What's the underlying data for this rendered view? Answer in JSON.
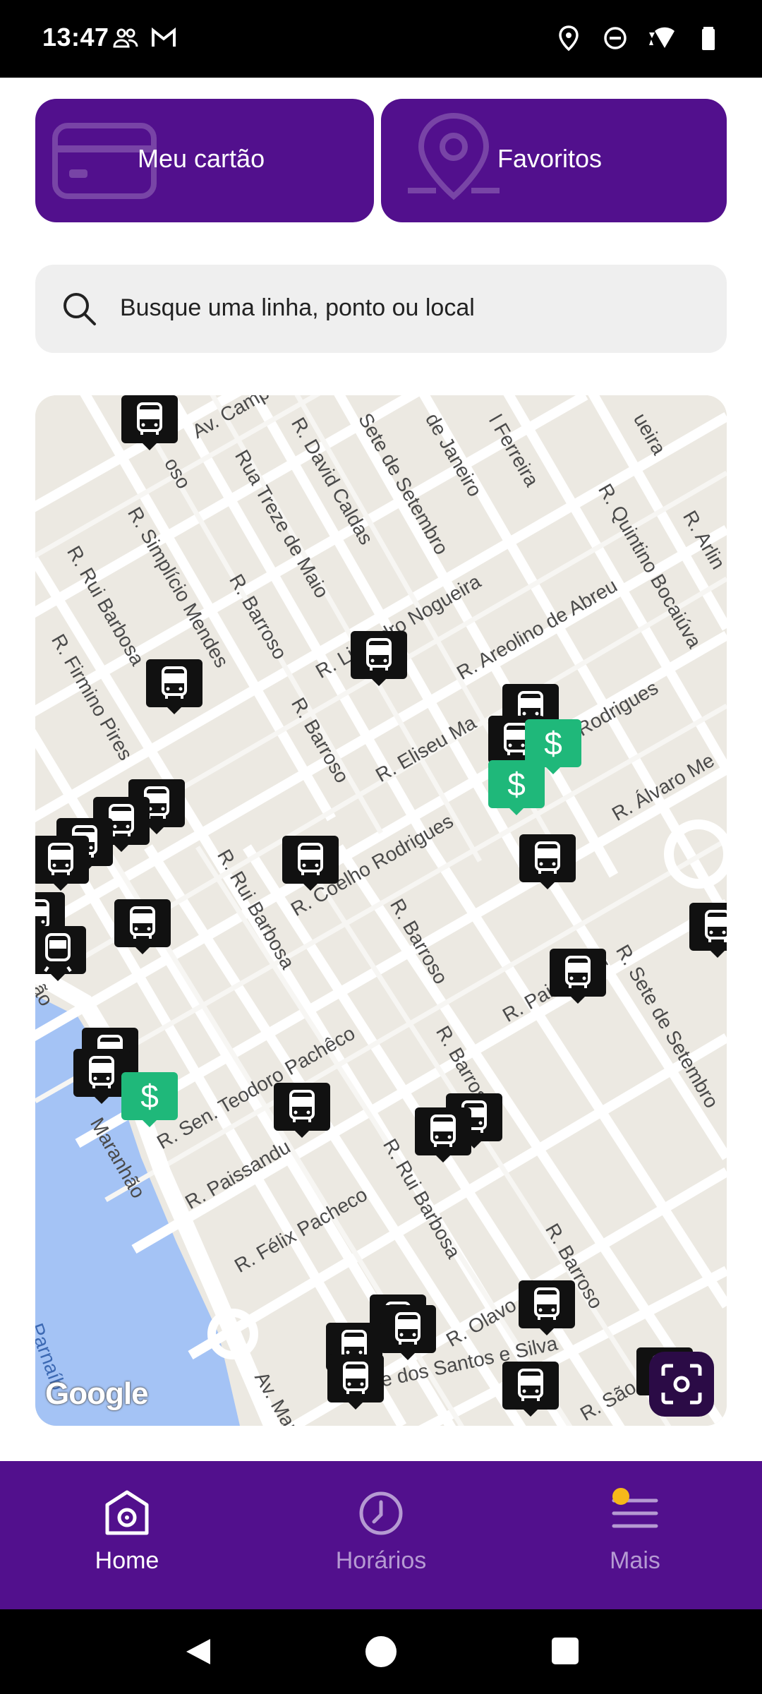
{
  "status_bar": {
    "time": "13:47",
    "left_icons": [
      "people-icon",
      "gmail-icon"
    ],
    "right_icons": [
      "location-icon",
      "dnd-icon",
      "wifi-icon",
      "battery-icon"
    ]
  },
  "quick_actions": [
    {
      "label": "Meu cartão",
      "icon": "card-icon"
    },
    {
      "label": "Favoritos",
      "icon": "map-pin-icon"
    }
  ],
  "search": {
    "placeholder": "Busque uma linha, ponto ou local",
    "icon": "search-icon"
  },
  "map": {
    "streets": [
      "Av. Camp",
      "R. David Caldas",
      "Sete de Setembro",
      "de Janeiro",
      "l Ferreira",
      "ueira",
      "R. Quintino Bocaiúva",
      "R. Arlin",
      "R. Simplício Mendes",
      "Rua Treze de Maio",
      "R. Rui Barbosa",
      "R. Barroso",
      "R. Firmino Pires",
      "R. Lisandro Nogueira",
      "R. Areolino de Abreu",
      "R. Eliseu Ma",
      "Rodrigues",
      "R. Álvaro Me",
      "R. Barroso",
      "R. Coelho Rodrigues",
      "R. Rui Barbosa",
      "R. Barroso",
      "R. Sete de Setembro",
      "R. Paissandu",
      "R. Barroso",
      "R. Sen. Teodoro Pachêco",
      "Maranhão",
      "R. Paissandu",
      "R. Rui Barbosa",
      "R. Félix Pacheco",
      "R. Barroso",
      "R. Olavo",
      "e dos Santos e Silva",
      "Av. Mara",
      "Parnaíb",
      "R. São",
      "oso",
      "ão"
    ],
    "attribution": "Google",
    "marker_types": [
      "bus-stop-icon",
      "recharge-point-icon",
      "train-icon"
    ]
  },
  "bottom_nav": [
    {
      "label": "Home",
      "icon": "home-icon",
      "active": true
    },
    {
      "label": "Horários",
      "icon": "clock-icon",
      "active": false
    },
    {
      "label": "Mais",
      "icon": "menu-icon",
      "active": false,
      "badge": true
    }
  ],
  "colors": {
    "brand": "#52108d",
    "recharge": "#1fb87a",
    "map_bg": "#ece9e2",
    "water": "#a4c3f5"
  }
}
